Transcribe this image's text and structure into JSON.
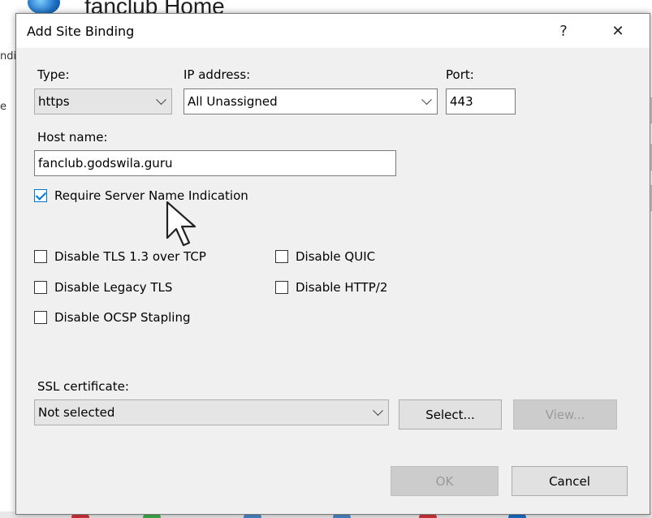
{
  "background_window": {
    "title": "fanclub Home",
    "left_fragments": [
      "ndi",
      "e"
    ]
  },
  "dialog": {
    "title": "Add Site Binding",
    "help_glyph": "?",
    "close_glyph": "✕",
    "type": {
      "label": "Type:",
      "value": "https"
    },
    "ip_address": {
      "label": "IP address:",
      "value": "All Unassigned"
    },
    "port": {
      "label": "Port:",
      "value": "443"
    },
    "host_name": {
      "label": "Host name:",
      "value": "fanclub.godswila.guru"
    },
    "options": {
      "require_sni": {
        "label": "Require Server Name Indication",
        "checked": true
      },
      "disable_tls13_tcp": {
        "label": "Disable TLS 1.3 over TCP",
        "checked": false
      },
      "disable_quic": {
        "label": "Disable QUIC",
        "checked": false
      },
      "disable_legacy_tls": {
        "label": "Disable Legacy TLS",
        "checked": false
      },
      "disable_http2": {
        "label": "Disable HTTP/2",
        "checked": false
      },
      "disable_ocsp": {
        "label": "Disable OCSP Stapling",
        "checked": false
      }
    },
    "ssl_certificate": {
      "label": "SSL certificate:",
      "value": "Not selected",
      "select_label": "Select...",
      "view_label": "View..."
    },
    "buttons": {
      "ok": "OK",
      "cancel": "Cancel"
    }
  },
  "colors": {
    "accent": "#0078d7",
    "dialog_bg": "#f0f0f0",
    "disabled_text": "#9a9a9a"
  },
  "icons": {
    "globe": "globe-icon",
    "cursor": "mouse-pointer-icon",
    "chevron": "chevron-down-icon"
  }
}
